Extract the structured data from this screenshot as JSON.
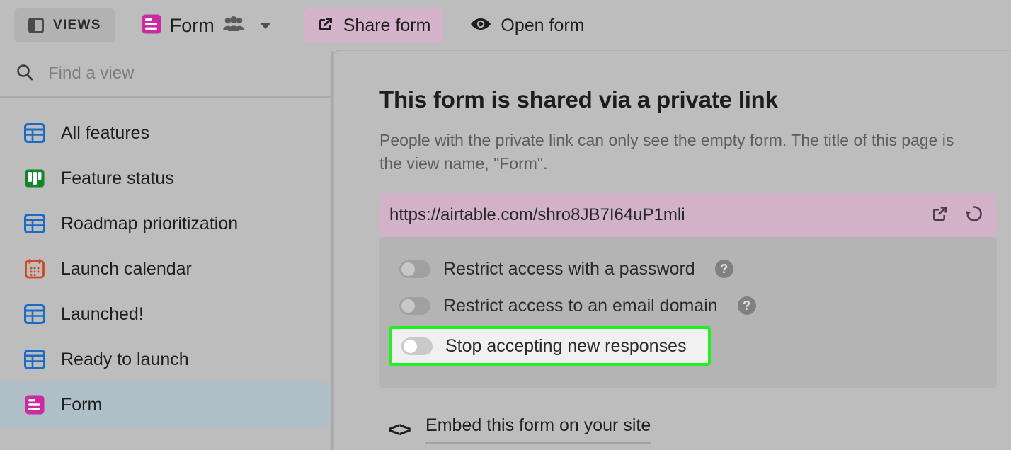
{
  "toolbar": {
    "views_button": {
      "label": "VIEWS",
      "icon": "panel-icon"
    },
    "form_tab": {
      "label": "Form",
      "icon": "form-view-icon",
      "collaborators_icon": "people-icon",
      "caret_icon": "chevron-down-icon"
    },
    "share_button": {
      "label": "Share form",
      "icon": "external-link-icon"
    },
    "open_button": {
      "label": "Open form",
      "icon": "eye-icon"
    }
  },
  "sidebar": {
    "search": {
      "placeholder": "Find a view",
      "icon": "search-icon"
    },
    "items": [
      {
        "label": "All features",
        "icon": "grid-view-icon",
        "color": "#1A6BC4",
        "selected": false
      },
      {
        "label": "Feature status",
        "icon": "kanban-view-icon",
        "color": "#13852A",
        "selected": false
      },
      {
        "label": "Roadmap prioritization",
        "icon": "grid-view-icon",
        "color": "#1A6BC4",
        "selected": false
      },
      {
        "label": "Launch calendar",
        "icon": "calendar-view-icon",
        "color": "#CC4A22",
        "selected": false
      },
      {
        "label": "Launched!",
        "icon": "grid-view-icon",
        "color": "#1A6BC4",
        "selected": false
      },
      {
        "label": "Ready to launch",
        "icon": "grid-view-icon",
        "color": "#1A6BC4",
        "selected": false
      },
      {
        "label": "Form",
        "icon": "form-view-icon",
        "color": "#CC2BA0",
        "selected": true
      }
    ]
  },
  "dialog": {
    "title": "This form is shared via a private link",
    "description": "People with the private link can only see the empty form. The title of this page is the view name, \"Form\".",
    "link": {
      "url": "https://airtable.com/shro8JB7I64uP1mli",
      "open_icon": "external-link-icon",
      "refresh_icon": "regenerate-link-icon"
    },
    "settings": [
      {
        "label": "Restrict access with a password",
        "enabled": false,
        "help_icon": "help-icon",
        "help_glyph": "?",
        "highlighted": false
      },
      {
        "label": "Restrict access to an email domain",
        "enabled": false,
        "help_icon": "help-icon",
        "help_glyph": "?",
        "highlighted": false
      },
      {
        "label": "Stop accepting new responses",
        "enabled": false,
        "highlighted": true
      }
    ],
    "embed": {
      "label": "Embed this form on your site",
      "icon": "code-brackets-icon",
      "glyph": "<>"
    }
  },
  "colors": {
    "app_background": "#bdbdbd",
    "share_button": "#d4b3cb",
    "link_bar": "#d2b2c8",
    "selected_view": "#aebfc7",
    "highlight_border": "#22f022",
    "form_accent": "#CC2BA0"
  }
}
